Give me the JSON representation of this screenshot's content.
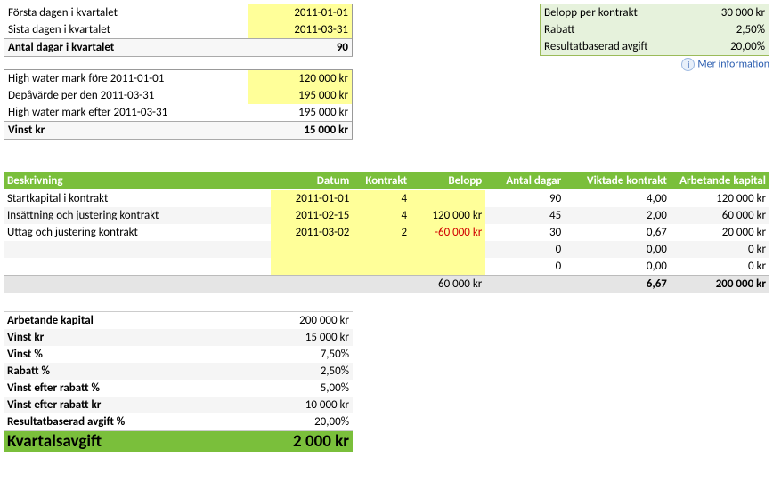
{
  "quarter": {
    "first_day_label": "Första dagen i kvartalet",
    "first_day_value": "2011-01-01",
    "last_day_label": "Sista dagen i kvartalet",
    "last_day_value": "2011-03-31",
    "days_label": "Antal dagar i kvartalet",
    "days_value": "90"
  },
  "hwm": {
    "before_label": "High water mark före 2011-01-01",
    "before_value": "120 000 kr",
    "depot_label": "Depåvärde per den 2011-03-31",
    "depot_value": "195 000 kr",
    "after_label": "High water mark efter 2011-03-31",
    "after_value": "195 000 kr",
    "profit_label": "Vinst kr",
    "profit_value": "15 000 kr"
  },
  "contract_box": {
    "per_contract_label": "Belopp per kontrakt",
    "per_contract_value": "30 000 kr",
    "discount_label": "Rabatt",
    "discount_value": "2,50%",
    "result_fee_label": "Resultatbaserad avgift",
    "result_fee_value": "20,00%",
    "info_text": "Mer information",
    "info_glyph": "i"
  },
  "main_table": {
    "headers": {
      "beskrivning": "Beskrivning",
      "datum": "Datum",
      "kontrakt": "Kontrakt",
      "belopp": "Belopp",
      "antal_dagar": "Antal dagar",
      "viktade": "Viktade kontrakt",
      "arbetande": "Arbetande kapital"
    },
    "rows": [
      {
        "beskr": "Startkapital i kontrakt",
        "datum": "2011-01-01",
        "kontrakt": "4",
        "belopp": "",
        "dagar": "90",
        "vikt": "4,00",
        "arb": "120 000 kr"
      },
      {
        "beskr": "Insättning och justering kontrakt",
        "datum": "2011-02-15",
        "kontrakt": "4",
        "belopp": "120 000 kr",
        "dagar": "45",
        "vikt": "2,00",
        "arb": "60 000 kr"
      },
      {
        "beskr": "Uttag och justering kontrakt",
        "datum": "2011-03-02",
        "kontrakt": "2",
        "belopp": "-60 000 kr",
        "dagar": "30",
        "vikt": "0,67",
        "arb": "20 000 kr"
      },
      {
        "beskr": "",
        "datum": "",
        "kontrakt": "",
        "belopp": "",
        "dagar": "0",
        "vikt": "0,00",
        "arb": "0 kr"
      },
      {
        "beskr": "",
        "datum": "",
        "kontrakt": "",
        "belopp": "",
        "dagar": "0",
        "vikt": "0,00",
        "arb": "0 kr"
      }
    ],
    "total": {
      "belopp": "60 000 kr",
      "vikt": "6,67",
      "arb": "200 000 kr"
    }
  },
  "summary": {
    "rows": [
      {
        "label": "Arbetande kapital",
        "value": "200 000 kr"
      },
      {
        "label": "Vinst kr",
        "value": "15 000 kr"
      },
      {
        "label": "Vinst %",
        "value": "7,50%"
      },
      {
        "label": "Rabatt %",
        "value": "2,50%"
      },
      {
        "label": "Vinst efter rabatt %",
        "value": "5,00%"
      },
      {
        "label": "Vinst efter rabatt kr",
        "value": "10 000 kr"
      },
      {
        "label": "Resultatbaserad avgift %",
        "value": "20,00%"
      }
    ],
    "final_label": "Kvartalsavgift",
    "final_value": "2 000 kr"
  },
  "chart_data": {
    "type": "table",
    "title": "Kvartalsavgift beräkning",
    "transactions": {
      "columns": [
        "Beskrivning",
        "Datum",
        "Kontrakt",
        "Belopp",
        "Antal dagar",
        "Viktade kontrakt",
        "Arbetande kapital"
      ],
      "rows": [
        [
          "Startkapital i kontrakt",
          "2011-01-01",
          4,
          null,
          90,
          4.0,
          120000
        ],
        [
          "Insättning och justering kontrakt",
          "2011-02-15",
          4,
          120000,
          45,
          2.0,
          60000
        ],
        [
          "Uttag och justering kontrakt",
          "2011-03-02",
          2,
          -60000,
          30,
          0.67,
          20000
        ],
        [
          "",
          "",
          null,
          null,
          0,
          0.0,
          0
        ],
        [
          "",
          "",
          null,
          null,
          0,
          0.0,
          0
        ]
      ],
      "totals": {
        "Belopp": 60000,
        "Viktade kontrakt": 6.67,
        "Arbetande kapital": 200000
      }
    },
    "parameters": {
      "Belopp per kontrakt": 30000,
      "Rabatt": 0.025,
      "Resultatbaserad avgift": 0.2,
      "Första dagen i kvartalet": "2011-01-01",
      "Sista dagen i kvartalet": "2011-03-31",
      "Antal dagar i kvartalet": 90,
      "High water mark före": 120000,
      "Depåvärde": 195000,
      "High water mark efter": 195000,
      "Vinst kr": 15000
    },
    "result": {
      "Arbetande kapital": 200000,
      "Vinst kr": 15000,
      "Vinst %": 0.075,
      "Rabatt %": 0.025,
      "Vinst efter rabatt %": 0.05,
      "Vinst efter rabatt kr": 10000,
      "Resultatbaserad avgift %": 0.2,
      "Kvartalsavgift": 2000
    }
  }
}
